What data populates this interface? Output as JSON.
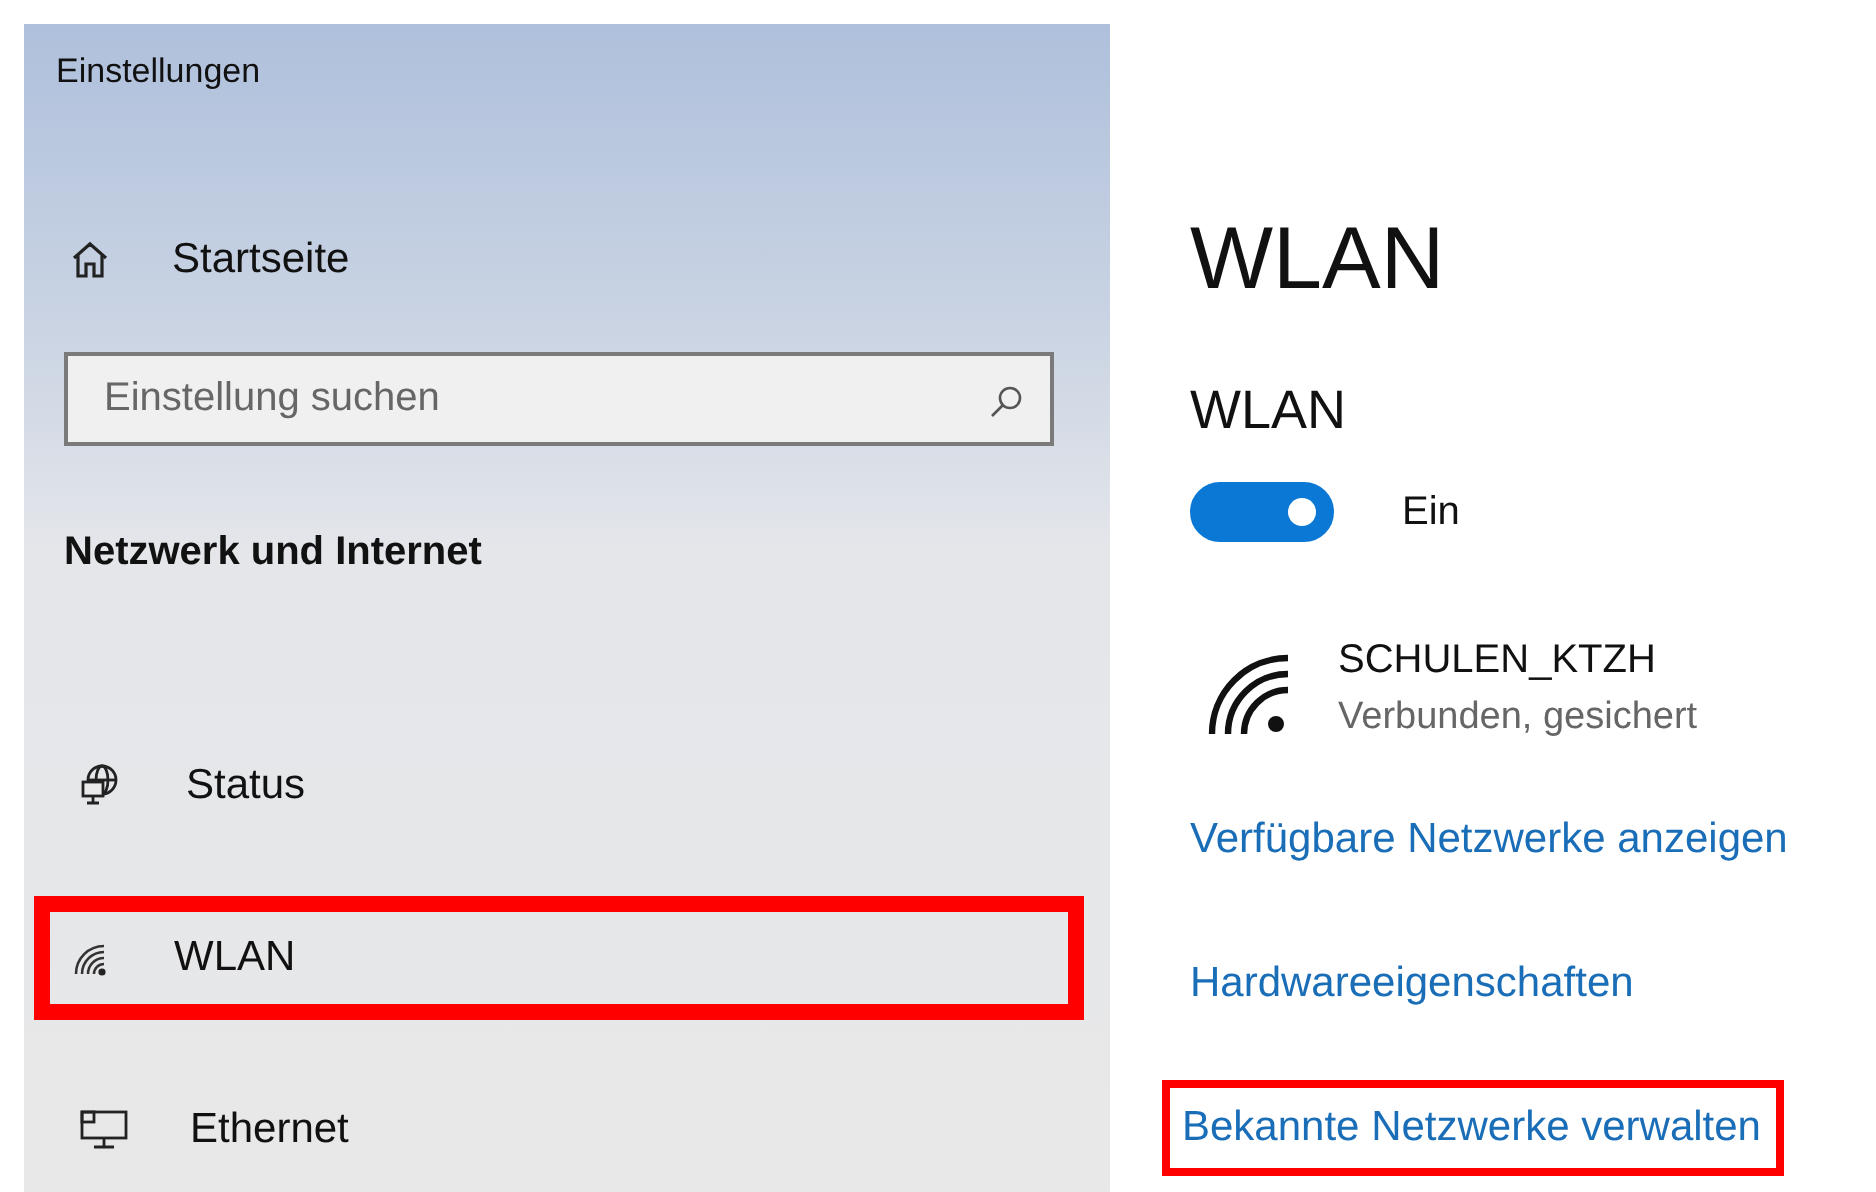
{
  "window": {
    "title": "Einstellungen"
  },
  "sidebar": {
    "home": {
      "label": "Startseite"
    },
    "search": {
      "placeholder": "Einstellung suchen"
    },
    "section_title": "Netzwerk und Internet",
    "items": [
      {
        "kind": "status",
        "label": "Status",
        "highlighted": false
      },
      {
        "kind": "wifi",
        "label": "WLAN",
        "highlighted": true
      },
      {
        "kind": "ethernet",
        "label": "Ethernet",
        "highlighted": false
      }
    ]
  },
  "content": {
    "title": "WLAN",
    "section_title": "WLAN",
    "toggle": {
      "on": true,
      "label": "Ein"
    },
    "network": {
      "name": "SCHULEN_KTZH",
      "status": "Verbunden, gesichert"
    },
    "links": [
      {
        "label": "Verfügbare Netzwerke anzeigen",
        "highlighted": false
      },
      {
        "label": "Hardwareeigenschaften",
        "highlighted": false
      },
      {
        "label": "Bekannte Netzwerke verwalten",
        "highlighted": true
      }
    ]
  }
}
